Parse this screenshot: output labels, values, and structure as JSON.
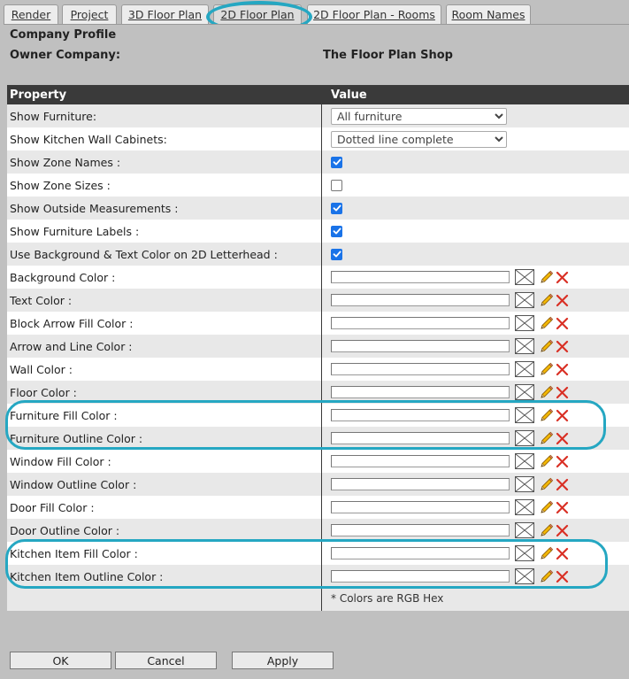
{
  "tabs": [
    {
      "label": "Render"
    },
    {
      "label": "Project"
    },
    {
      "label": "3D Floor Plan"
    },
    {
      "label": "2D Floor Plan",
      "active": true
    },
    {
      "label": "2D Floor Plan - Rooms"
    },
    {
      "label": "Room Names"
    }
  ],
  "profile": {
    "title": "Company Profile",
    "owner_label": "Owner Company:",
    "owner_value": "The Floor Plan Shop"
  },
  "grid": {
    "header_property": "Property",
    "header_value": "Value",
    "rows": [
      {
        "label": "Show Furniture:",
        "type": "select",
        "value": "All furniture"
      },
      {
        "label": "Show Kitchen Wall Cabinets:",
        "type": "select",
        "value": "Dotted line complete"
      },
      {
        "label": "Show Zone Names :",
        "type": "checkbox",
        "checked": true
      },
      {
        "label": "Show Zone Sizes :",
        "type": "checkbox",
        "checked": false
      },
      {
        "label": "Show Outside Measurements :",
        "type": "checkbox",
        "checked": true
      },
      {
        "label": "Show Furniture Labels :",
        "type": "checkbox",
        "checked": true
      },
      {
        "label": "Use Background & Text Color on 2D Letterhead :",
        "type": "checkbox",
        "checked": true
      },
      {
        "label": "Background Color :",
        "type": "color",
        "value": ""
      },
      {
        "label": "Text Color :",
        "type": "color",
        "value": ""
      },
      {
        "label": "Block Arrow Fill Color :",
        "type": "color",
        "value": ""
      },
      {
        "label": "Arrow and Line Color :",
        "type": "color",
        "value": ""
      },
      {
        "label": "Wall Color :",
        "type": "color",
        "value": ""
      },
      {
        "label": "Floor Color :",
        "type": "color",
        "value": ""
      },
      {
        "label": "Furniture Fill Color :",
        "type": "color",
        "value": ""
      },
      {
        "label": "Furniture Outline Color :",
        "type": "color",
        "value": ""
      },
      {
        "label": "Window Fill Color :",
        "type": "color",
        "value": ""
      },
      {
        "label": "Window Outline Color :",
        "type": "color",
        "value": ""
      },
      {
        "label": "Door Fill Color :",
        "type": "color",
        "value": ""
      },
      {
        "label": "Door Outline Color :",
        "type": "color",
        "value": ""
      },
      {
        "label": "Kitchen Item Fill Color :",
        "type": "color",
        "value": ""
      },
      {
        "label": "Kitchen Item Outline Color :",
        "type": "color",
        "value": ""
      }
    ],
    "footnote": "* Colors are RGB Hex"
  },
  "buttons": {
    "ok": "OK",
    "cancel": "Cancel",
    "apply": "Apply"
  },
  "colors": {
    "highlight": "#25a7c2",
    "header_bg": "#3a3a3a",
    "checkbox_on": "#1a73e8",
    "delete_red": "#d93025",
    "pencil_yellow": "#f2b705"
  },
  "icons": {
    "swatch": "empty-swatch-icon",
    "edit": "pencil-icon",
    "delete": "delete-x-icon",
    "check": "checkmark-icon"
  }
}
